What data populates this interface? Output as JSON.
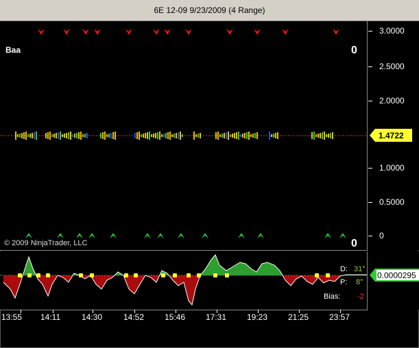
{
  "window": {
    "title": "6E 12-09  9/23/2009 (4 Range)"
  },
  "price_panel": {
    "indicator_label": "Baa",
    "top_right_value": "0",
    "bottom_right_value": "0",
    "copyright": "© 2009 NinjaTrader, LLC",
    "current_price": "1.4722",
    "y_ticks": [
      "3.0000",
      "2.5000",
      "2.0000",
      "1.0000",
      "0.5000",
      "0"
    ]
  },
  "osc_panel": {
    "current_value": "0.0000295",
    "d_label": "D:",
    "d_value": "31°",
    "p_label": "P:",
    "p_value": "8°",
    "bias_label": "Bias:",
    "bias_value": "-2"
  },
  "x_axis": {
    "labels": [
      "13:55",
      "14:11",
      "14:30",
      "14:52",
      "15:46",
      "17:31",
      "19:23",
      "21:25",
      "23:57"
    ]
  },
  "colors": {
    "up_arrow": "#2ec52e",
    "down_arrow": "#ff1010",
    "price_marker": "#ffff33",
    "osc_marker": "#33cc33",
    "osc_fill_up": "#2e9e2e",
    "osc_fill_down": "#e01010"
  }
}
